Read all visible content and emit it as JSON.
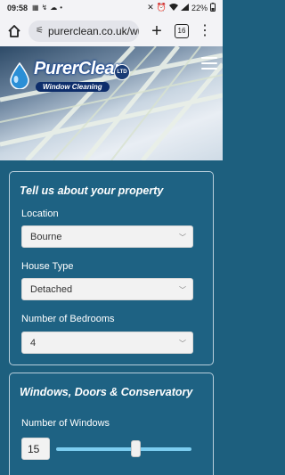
{
  "status": {
    "time": "09:58",
    "battery": "22%"
  },
  "browser": {
    "url": "purerclean.co.uk/wi",
    "tab_count": "16"
  },
  "brand": {
    "name": "PurerClean",
    "ltd": "LTD",
    "tagline": "Window Cleaning"
  },
  "property_section": {
    "title": "Tell us about your property",
    "location": {
      "label": "Location",
      "value": "Bourne"
    },
    "house_type": {
      "label": "House Type",
      "value": "Detached"
    },
    "bedrooms": {
      "label": "Number of Bedrooms",
      "value": "4"
    }
  },
  "windows_section": {
    "title": "Windows, Doors & Conservatory",
    "windows": {
      "label": "Number of Windows",
      "value": "15",
      "slider_fraction": 0.59
    }
  },
  "colors": {
    "page_bg": "#1d5f7e",
    "slider_track": "#7ccdf0"
  }
}
